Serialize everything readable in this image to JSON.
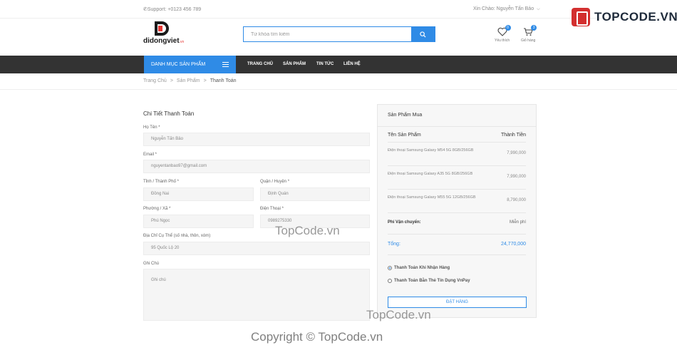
{
  "topbar": {
    "support": "✆Support: +0123 456 789",
    "greeting": "Xin Chào: Nguyễn Tấn Bảo",
    "greeting_chevron": "⌵"
  },
  "watermark": {
    "brand": "TOPCODE.VN",
    "center": "TopCode.vn",
    "lower": "TopCode.vn",
    "copyright": "Copyright © TopCode.vn"
  },
  "header": {
    "logo_text": "didongviet",
    "logo_suffix": ".vn",
    "search_placeholder": "Từ khóa tìm kiếm",
    "wishlist_label": "Yêu thích",
    "wishlist_count": "0",
    "cart_label": "Giỏ hàng",
    "cart_count": "3"
  },
  "nav": {
    "category": "DANH MỤC SẢN PHẨM",
    "links": [
      "TRANG CHỦ",
      "SẢN PHẨM",
      "TIN TỨC",
      "LIÊN HỆ"
    ]
  },
  "breadcrumb": {
    "items": [
      "Trang Chủ",
      "Sản Phẩm",
      "Thanh Toán"
    ],
    "separator": ">"
  },
  "form": {
    "title": "Chi Tiết Thanh Toán",
    "name_label": "Họ Tên *",
    "name_value": "Nguyễn Tấn Bảo",
    "email_label": "Email *",
    "email_value": "nguyentanbao97@gmail.com",
    "province_label": "Tỉnh / Thành Phố *",
    "province_value": "Đồng Nai",
    "district_label": "Quận / Huyện *",
    "district_value": "Định Quán",
    "ward_label": "Phường / Xã *",
    "ward_value": "Phú Ngọc",
    "phone_label": "Điện Thoại *",
    "phone_value": "0989275330",
    "address_label": "Địa Chỉ Cụ Thể (số nhà, thôn, xóm)",
    "address_value": "95 Quốc Lộ 20",
    "note_label": "Ghi Chú",
    "note_placeholder": "Ghi chú"
  },
  "order": {
    "title": "Sản Phẩm Mua",
    "col_name": "Tên Sản Phẩm",
    "col_total": "Thành Tiền",
    "items": [
      {
        "name": "Điện thoại Samsung Galaxy M54 5G 8GB/256GB",
        "price": "7,990,000"
      },
      {
        "name": "Điện thoại Samsung Galaxy A35 5G 8GB/256GB",
        "price": "7,990,000"
      },
      {
        "name": "Điện thoại Samsung Galaxy M55 5G 12GB/256GB",
        "price": "8,790,000"
      }
    ],
    "shipping_label": "Phí Vận chuyển:",
    "shipping_value": "Miễn phí",
    "total_label": "Tổng:",
    "total_value": "24,770,000",
    "payment_cod": "Thanh Toán Khi Nhận Hàng",
    "payment_card": "Thanh Toán Bằn Thẻ Tín Dụng VnPay",
    "submit": "ĐẶT HÀNG"
  },
  "colors": {
    "accent": "#2f8be6",
    "nav_bg": "#333333",
    "logo_red": "#e53935"
  }
}
